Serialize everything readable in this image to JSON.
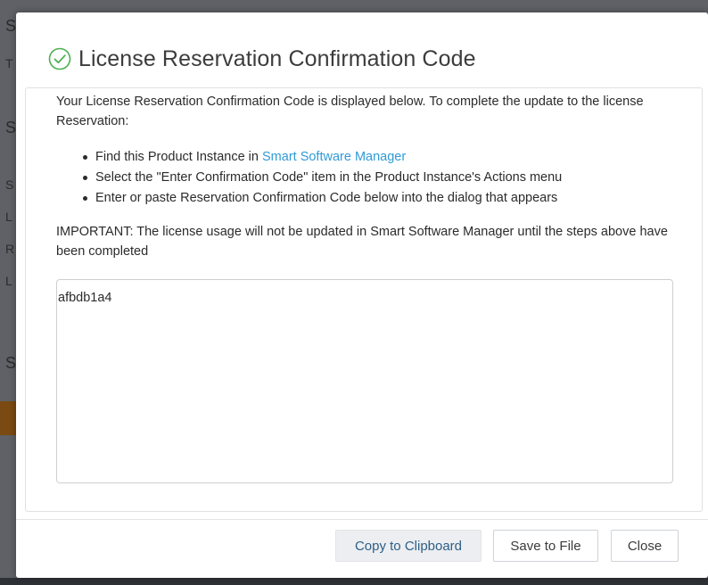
{
  "background": {
    "letters": [
      "S",
      "T",
      "S",
      "S",
      "L",
      "R",
      "L",
      "S"
    ]
  },
  "dialog": {
    "title": "License Reservation Confirmation Code",
    "title_icon": "check-circle-icon",
    "accent_color": "#4caf50",
    "intro": "Your License Reservation Confirmation Code is displayed below. To complete the update to the license Reservation:",
    "steps": [
      {
        "prefix": "Find this Product Instance in ",
        "link": "Smart Software Manager"
      },
      {
        "text": "Select the \"Enter Confirmation Code\" item in the Product Instance's Actions menu"
      },
      {
        "text": "Enter or paste Reservation Confirmation Code below into the dialog that appears"
      }
    ],
    "important": "IMPORTANT: The license usage will not be updated in Smart Software Manager until the steps above have been completed",
    "code": "afbdb1a4",
    "link_color": "#2f9bd6"
  },
  "buttons": {
    "copy": "Copy to Clipboard",
    "save": "Save to File",
    "close": "Close"
  }
}
